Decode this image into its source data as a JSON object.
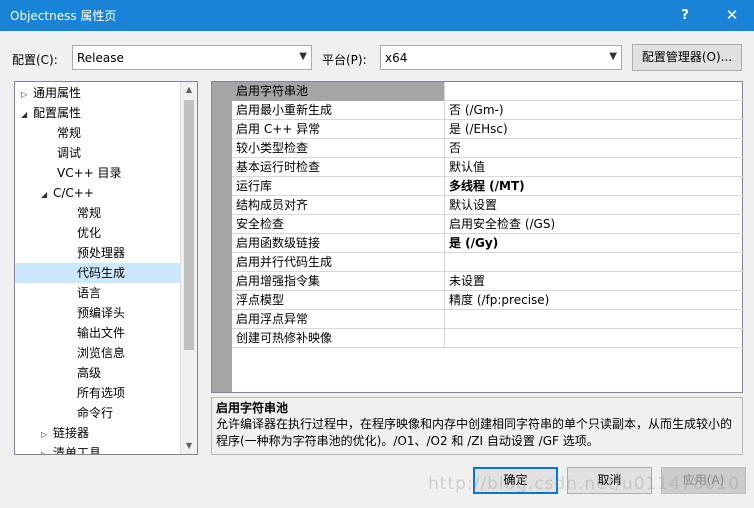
{
  "window": {
    "title": "Objectness 属性页",
    "help_icon": "?",
    "close_icon": "✕"
  },
  "config": {
    "label": "配置(C):",
    "value": "Release"
  },
  "platform": {
    "label": "平台(P):",
    "value": "x64"
  },
  "config_manager_label": "配置管理器(O)...",
  "tree": {
    "items": [
      {
        "label": "通用属性",
        "expander": "▷"
      },
      {
        "label": "配置属性",
        "expander": "◢"
      },
      {
        "label": "常规"
      },
      {
        "label": "调试"
      },
      {
        "label": "VC++ 目录"
      },
      {
        "label": "C/C++",
        "expander": "◢"
      },
      {
        "label": "常规"
      },
      {
        "label": "优化"
      },
      {
        "label": "预处理器"
      },
      {
        "label": "代码生成",
        "selected": true
      },
      {
        "label": "语言"
      },
      {
        "label": "预编译头"
      },
      {
        "label": "输出文件"
      },
      {
        "label": "浏览信息"
      },
      {
        "label": "高级"
      },
      {
        "label": "所有选项"
      },
      {
        "label": "命令行"
      },
      {
        "label": "链接器",
        "expander": "▷"
      },
      {
        "label": "清单工具",
        "expander": "▷"
      }
    ]
  },
  "grid": {
    "rows": [
      {
        "name": "启用字符串池",
        "value": ""
      },
      {
        "name": "启用最小重新生成",
        "value": "否 (/Gm-)"
      },
      {
        "name": "启用 C++ 异常",
        "value": "是 (/EHsc)"
      },
      {
        "name": "较小类型检查",
        "value": "否"
      },
      {
        "name": "基本运行时检查",
        "value": "默认值"
      },
      {
        "name": "运行库",
        "value": "多线程 (/MT)"
      },
      {
        "name": "结构成员对齐",
        "value": "默认设置"
      },
      {
        "name": "安全检查",
        "value": "启用安全检查 (/GS)"
      },
      {
        "name": "启用函数级链接",
        "value": "是 (/Gy)"
      },
      {
        "name": "启用并行代码生成",
        "value": ""
      },
      {
        "name": "启用增强指令集",
        "value": "未设置"
      },
      {
        "name": "浮点模型",
        "value": "精度 (/fp:precise)"
      },
      {
        "name": "启用浮点异常",
        "value": ""
      },
      {
        "name": "创建可热修补映像",
        "value": ""
      }
    ]
  },
  "description": {
    "title": "启用字符串池",
    "line1": "允许编译器在执行过程中，在程序映像和内存中创建相同字符串的单个只读副本，从而生成较小的",
    "line2": "程序(一种称为字符串池的优化)。/O1、/O2 和 /ZI 自动设置 /GF 选项。"
  },
  "buttons": {
    "ok": "确定",
    "cancel": "取消",
    "apply": "应用(A)"
  },
  "watermark": "http://blog.csdn.net/u011478010",
  "colors": {
    "titlebar": "#1883d7",
    "selection": "#cce8ff",
    "grid_header": "#a5a5a5"
  }
}
